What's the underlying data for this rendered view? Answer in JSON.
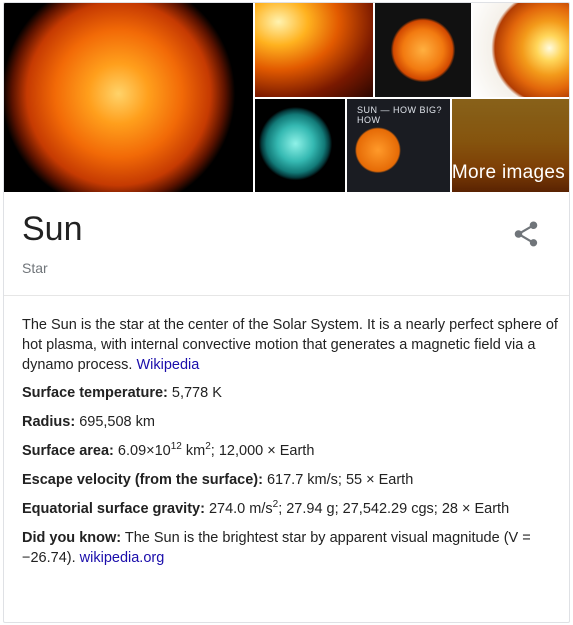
{
  "gallery": {
    "more_images_label": "More images",
    "infographic_label": "SUN — HOW BIG? HOW"
  },
  "entity": {
    "title": "Sun",
    "subtitle": "Star",
    "share_icon": "share-icon"
  },
  "description": {
    "text": "The Sun is the star at the center of the Solar System. It is a nearly perfect sphere of hot plasma, with internal convective motion that generates a magnetic field via a dynamo process.",
    "source_link": "Wikipedia"
  },
  "facts": [
    {
      "label": "Surface temperature:",
      "value": "5,778 K"
    },
    {
      "label": "Radius:",
      "value": "695,508 km"
    },
    {
      "label": "Surface area:",
      "value_pre": "6.09×10",
      "exp1": "12",
      "value_mid": " km",
      "exp2": "2",
      "value_post": "; 12,000 × Earth"
    },
    {
      "label": "Escape velocity (from the surface):",
      "value": "617.7 km/s; 55 × Earth"
    },
    {
      "label": "Equatorial surface gravity:",
      "value_pre": "274.0 m/s",
      "exp": "2",
      "value_post": "; 27.94 g; 27,542.29 cgs; 28 × Earth"
    }
  ],
  "did_you_know": {
    "label": "Did you know:",
    "text": "The Sun is the brightest star by apparent visual magnitude (V = −26.74).",
    "source_link": "wikipedia.org"
  },
  "colors": {
    "link": "#1a0dab",
    "subtitle": "#70757a",
    "icon": "#70757a"
  }
}
